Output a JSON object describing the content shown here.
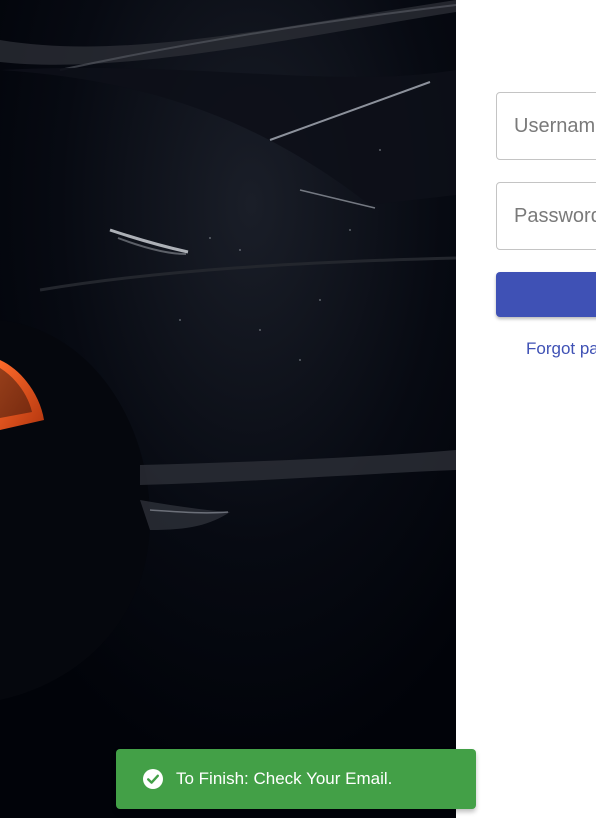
{
  "hero": {
    "image": "dark-car-detail-photo"
  },
  "login_form": {
    "username": {
      "placeholder": "Username",
      "value": ""
    },
    "password": {
      "placeholder": "Password",
      "value": ""
    },
    "submit_label": "",
    "forgot_password_label": "Forgot password?"
  },
  "notification": {
    "icon": "check-circle-icon",
    "message": "To Finish: Check Your Email."
  },
  "colors": {
    "primary": "#3f51b5",
    "success": "#43a047",
    "hero_background": "#02040c",
    "accent_orange": "#e2521f"
  }
}
